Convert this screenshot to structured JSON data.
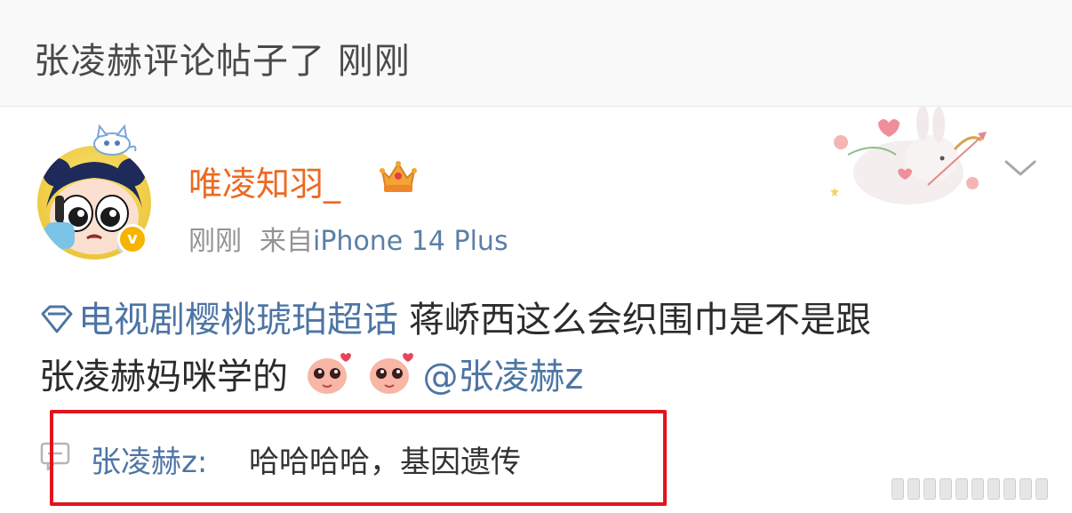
{
  "header": {
    "title": "张凌赫评论帖子了 刚刚"
  },
  "post": {
    "author": "唯凌知羽_",
    "time": "刚刚",
    "source_prefix": "来自",
    "device": "iPhone 14 Plus",
    "topic": "电视剧樱桃琥珀超话",
    "text_line1": "蒋峤西这么会织围巾是不是跟",
    "text_line2": "张凌赫妈咪学的",
    "mention": "@张凌赫z"
  },
  "comment": {
    "user": "张凌赫z:",
    "text": "哈哈哈哈，基因遗传"
  },
  "colors": {
    "username": "#ec6a22",
    "link": "#4d75a4",
    "highlight_box": "#e0141e",
    "verified": "#f5b400"
  },
  "icons": [
    "avatar",
    "crown-icon",
    "verified-icon",
    "chevron-down-icon",
    "topic-diamond-icon",
    "blush-emoji-icon",
    "comment-bubble-icon",
    "bunny-sticker"
  ]
}
